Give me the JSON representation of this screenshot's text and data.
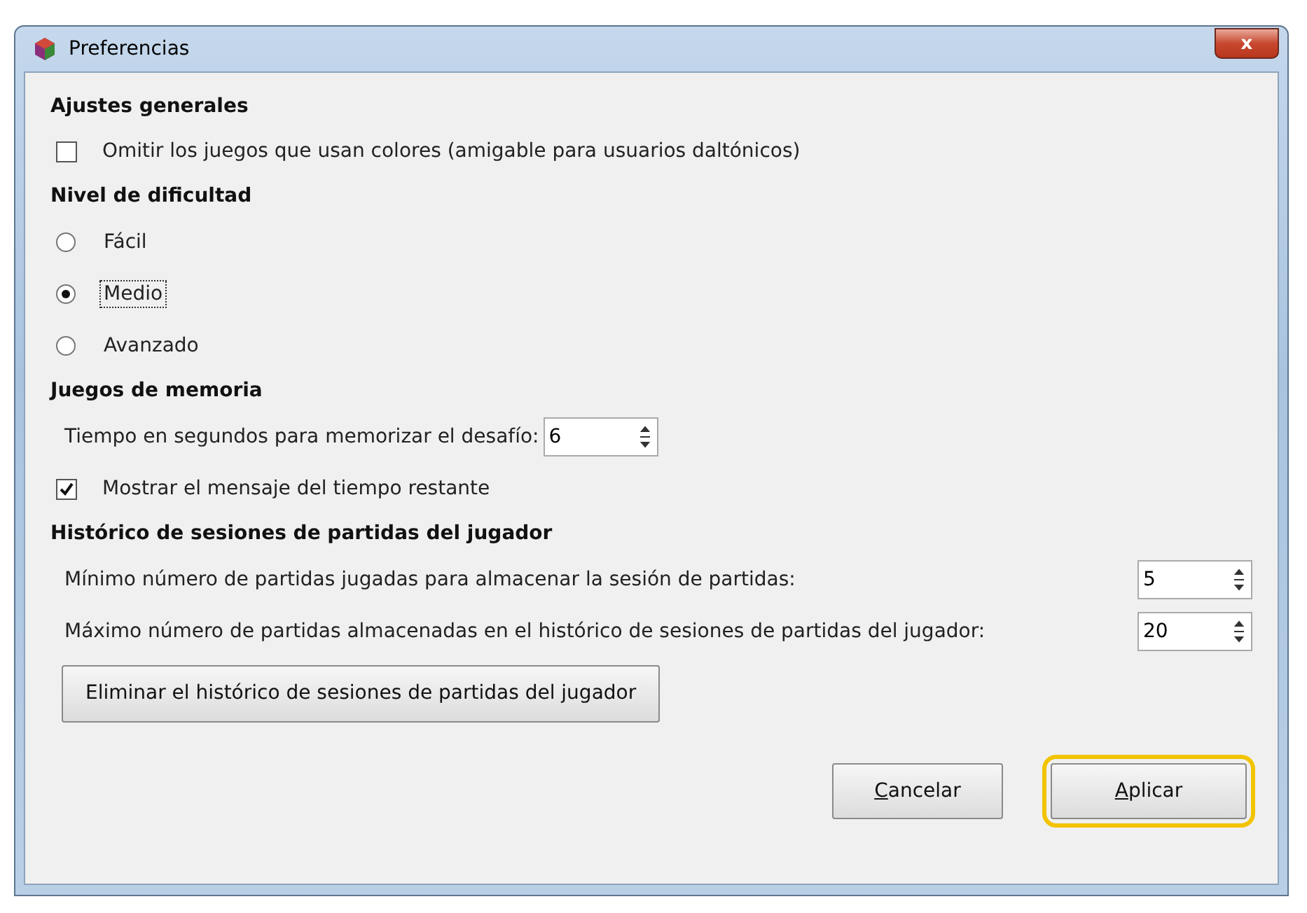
{
  "window": {
    "title": "Preferencias",
    "close": "x"
  },
  "sections": [
    {
      "title": "Ajustes generales",
      "items": [
        {
          "kind": "checkbox",
          "label": "Omitir los juegos que usan colores (amigable para usuarios daltónicos)",
          "checked": false
        }
      ]
    },
    {
      "title": "Nivel de dificultad",
      "items": [
        {
          "kind": "radio",
          "label": "Fácil",
          "selected": false
        },
        {
          "kind": "radio",
          "label": "Medio",
          "selected": true
        },
        {
          "kind": "radio",
          "label": "Avanzado",
          "selected": false
        }
      ]
    },
    {
      "title": "Juegos de memoria",
      "items": [
        {
          "kind": "spin",
          "label": "Tiempo en segundos para memorizar el desafío:",
          "value": "6"
        },
        {
          "kind": "checkbox",
          "label": "Mostrar el mensaje del tiempo restante",
          "checked": true
        }
      ]
    },
    {
      "title": "Histórico de sesiones de partidas del jugador",
      "items": [
        {
          "kind": "wide-spin",
          "label": "Mínimo número de partidas jugadas para almacenar la sesión de partidas:",
          "value": "5"
        },
        {
          "kind": "wide-spin",
          "label": "Máximo número de partidas almacenadas en el histórico de sesiones de partidas del jugador:",
          "value": "20"
        },
        {
          "kind": "button",
          "label": "Eliminar el histórico de sesiones de partidas del jugador"
        }
      ]
    }
  ],
  "buttons": [
    {
      "label": "Cancelar",
      "highlighted": false
    },
    {
      "label": "Aplicar",
      "highlighted": true
    }
  ]
}
